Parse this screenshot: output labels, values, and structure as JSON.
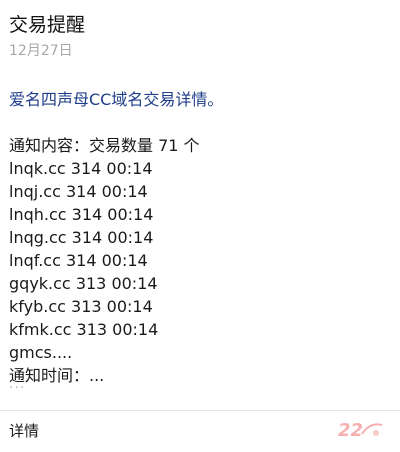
{
  "message": {
    "title": "交易提醒",
    "date": "12月27日",
    "intro": "爱名四声母CC域名交易详情。",
    "content_lines": [
      "通知内容：交易数量 71 个",
      "lnqk.cc  314  00:14",
      "lnqj.cc  314  00:14",
      "lnqh.cc  314  00:14",
      "lnqg.cc  314  00:14",
      "lnqf.cc  314  00:14",
      "gqyk.cc  313  00:14",
      "kfyb.cc  313  00:14",
      "kfmk.cc  313  00:14",
      "gmcs....",
      "通知时间：..."
    ],
    "ellipsis": "...",
    "details_label": "详情"
  },
  "colors": {
    "intro_text": "#1f3d8a",
    "date_text": "#a8a8a8",
    "watermark": "#f4a3a3"
  },
  "watermark": {
    "icon": "logo-22-watermark"
  }
}
